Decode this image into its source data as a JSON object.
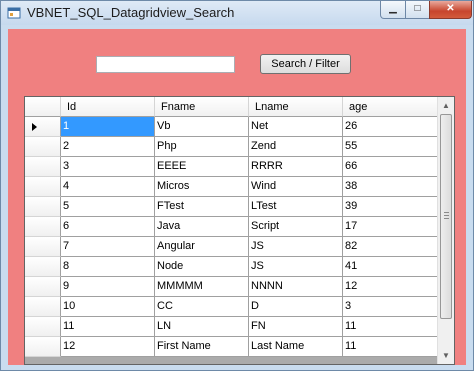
{
  "window": {
    "title": "VBNET_SQL_Datagridview_Search",
    "minimize_glyph": "▁",
    "maximize_glyph": "□",
    "close_glyph": "✕"
  },
  "toolbar": {
    "search_value": "",
    "search_label": "Search / Filter"
  },
  "grid": {
    "columns": [
      "Id",
      "Fname",
      "Lname",
      "age"
    ],
    "selected_row": 0,
    "rows": [
      [
        "1",
        "Vb",
        "Net",
        "26"
      ],
      [
        "2",
        "Php",
        "Zend",
        "55"
      ],
      [
        "3",
        "EEEE",
        "RRRR",
        "66"
      ],
      [
        "4",
        "Micros",
        "Wind",
        "38"
      ],
      [
        "5",
        "FTest",
        "LTest",
        "39"
      ],
      [
        "6",
        "Java",
        "Script",
        "17"
      ],
      [
        "7",
        "Angular",
        "JS",
        "82"
      ],
      [
        "8",
        "Node",
        "JS",
        "41"
      ],
      [
        "9",
        "MMMMM",
        "NNNN",
        "12"
      ],
      [
        "10",
        "CC",
        "D",
        "3"
      ],
      [
        "11",
        "LN",
        "FN",
        "11"
      ],
      [
        "12",
        "First Name",
        "Last Name",
        "11"
      ]
    ]
  },
  "colors": {
    "form_background": "#f08080",
    "selection": "#3399ff",
    "grid_background": "#ababab"
  },
  "icons": {
    "row_pointer": "right-triangle-icon",
    "app": "form-app-icon"
  }
}
